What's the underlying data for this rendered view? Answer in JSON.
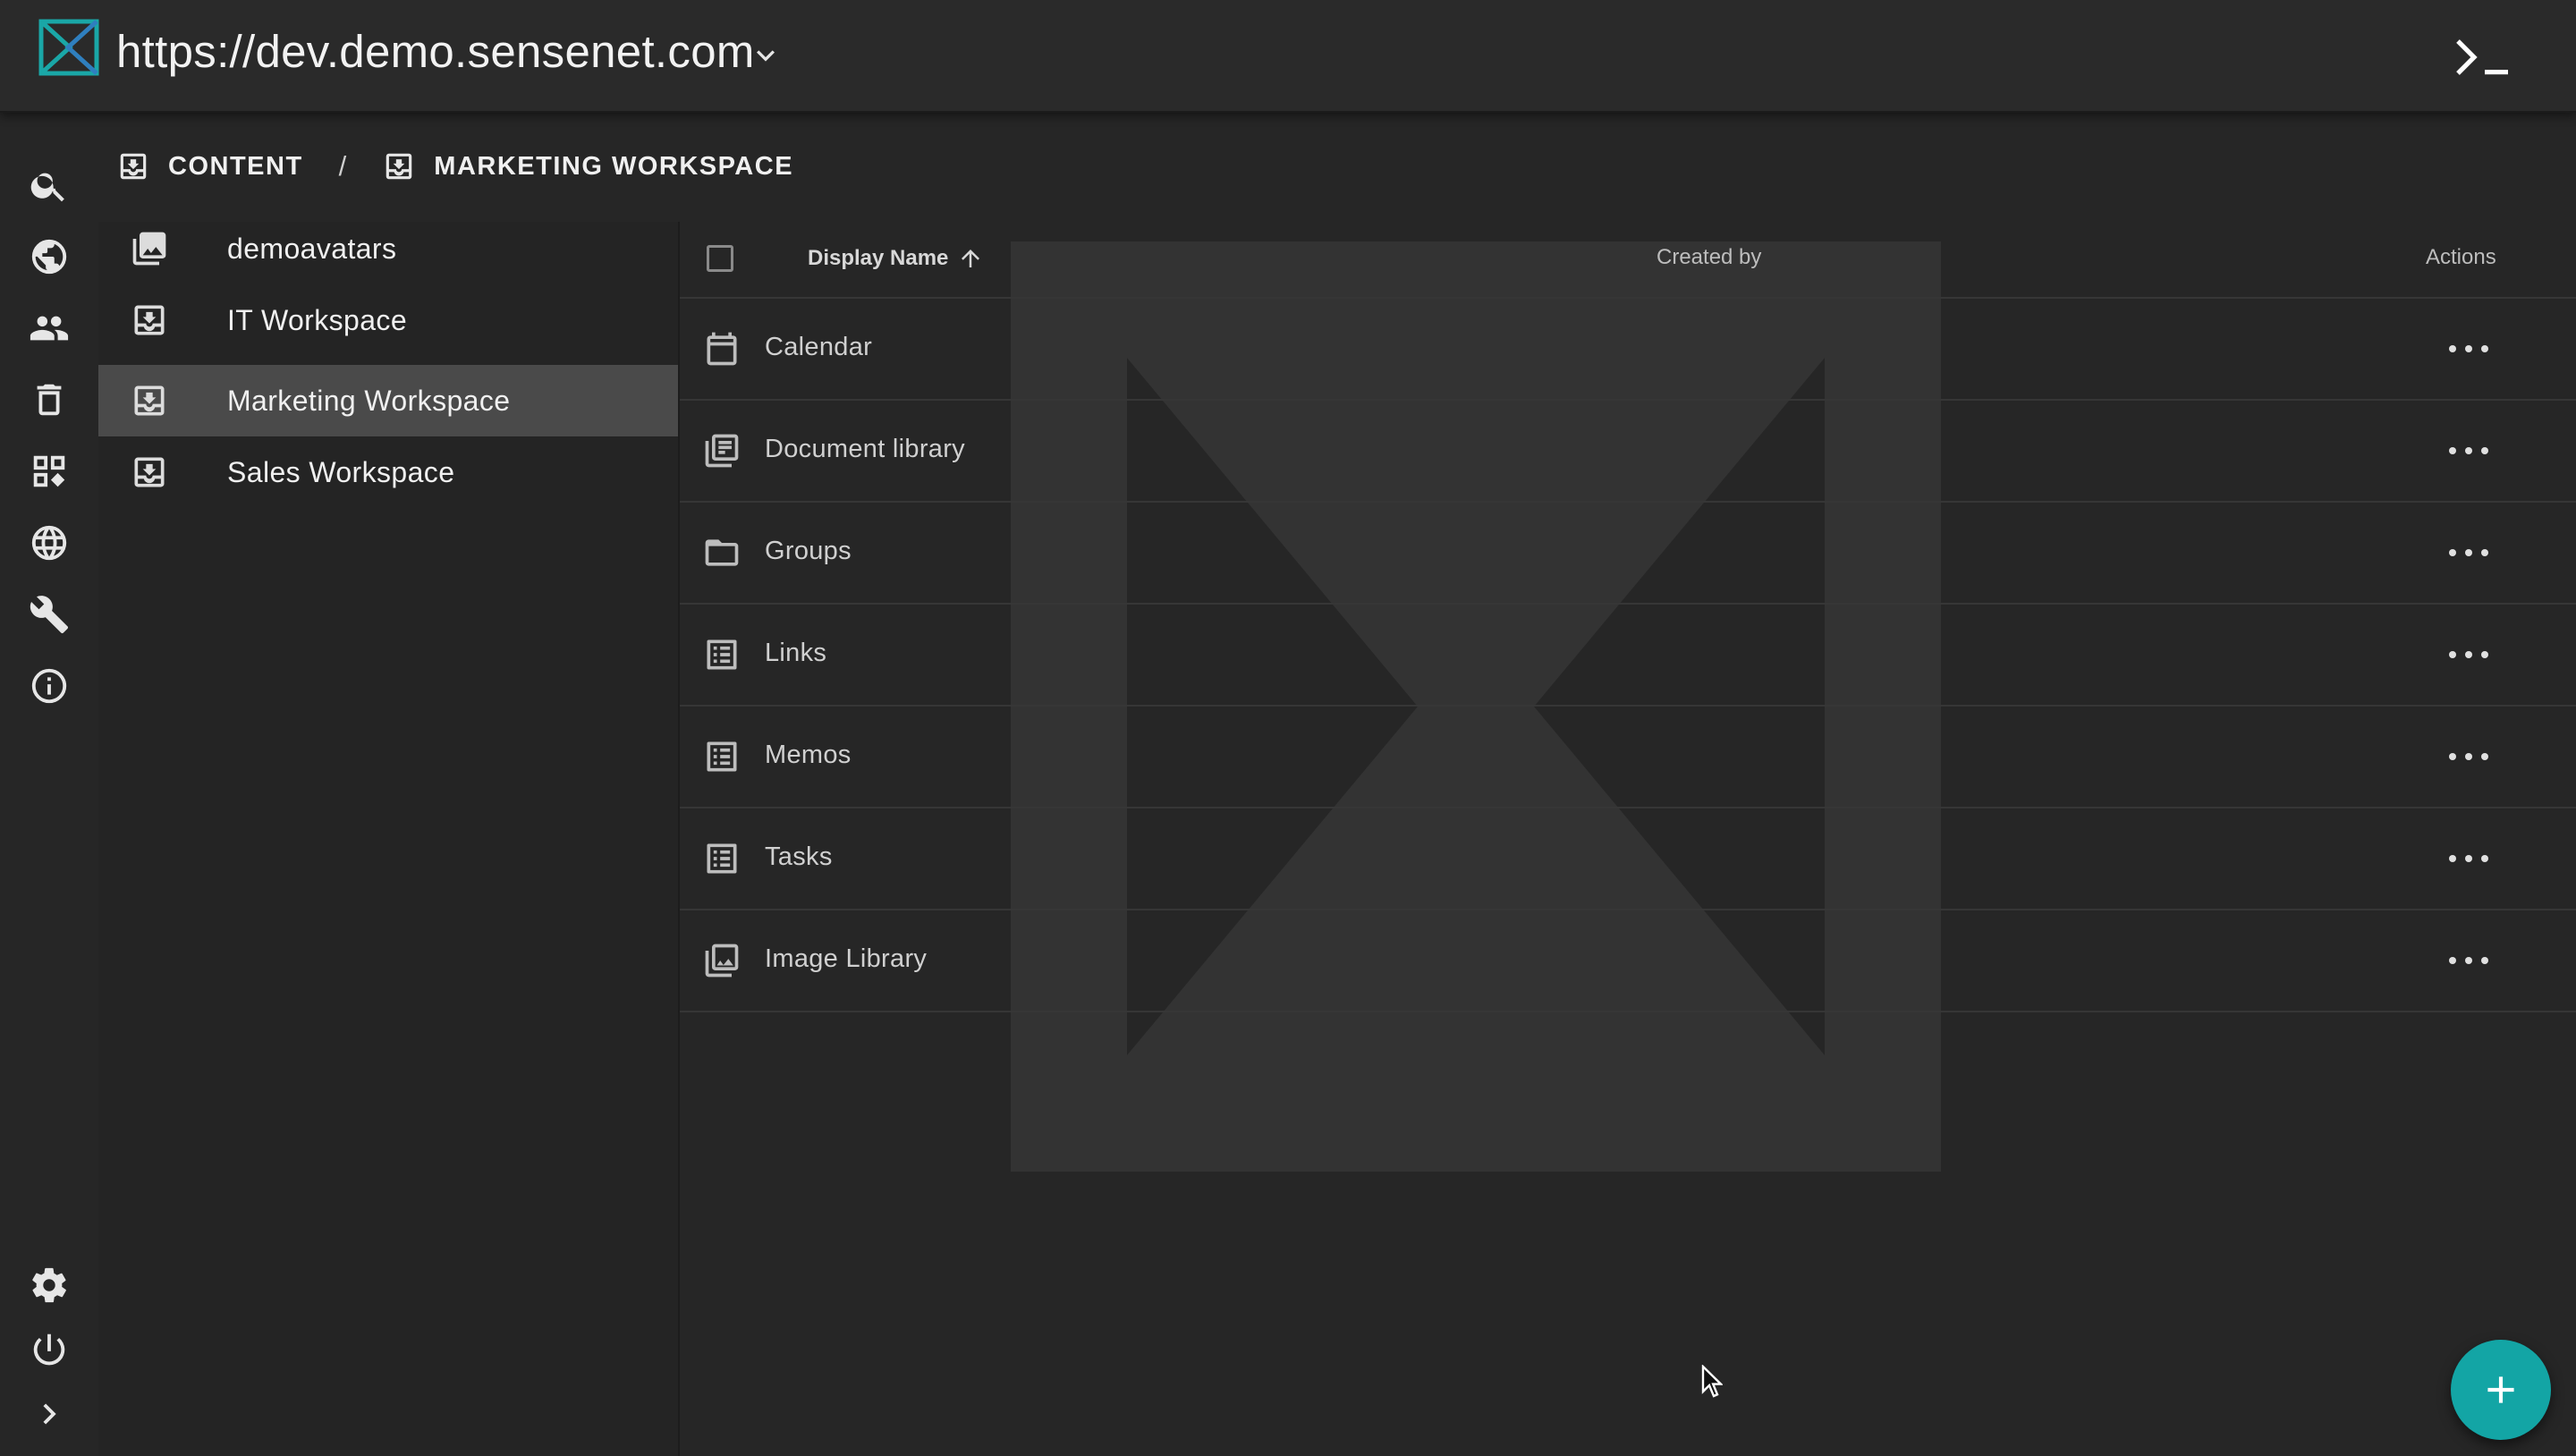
{
  "app": {
    "url": "https://dev.demo.sensenet.com",
    "brand_color": "#13a5a5"
  },
  "rail": {
    "items": [
      {
        "icon": "search-icon"
      },
      {
        "icon": "globe-content-icon"
      },
      {
        "icon": "users-icon"
      },
      {
        "icon": "trash-icon"
      },
      {
        "icon": "content-types-icon"
      },
      {
        "icon": "localization-icon"
      },
      {
        "icon": "setup-wrench-icon"
      },
      {
        "icon": "info-icon"
      },
      {
        "icon": "settings-gear-icon"
      },
      {
        "icon": "power-icon"
      },
      {
        "icon": "expand-chevron-icon"
      }
    ]
  },
  "breadcrumb": {
    "items": [
      "CONTENT",
      "MARKETING WORKSPACE"
    ],
    "separator": "/"
  },
  "tree": {
    "items": [
      {
        "label": "demoavatars",
        "icon": "image-library-icon",
        "selected": false
      },
      {
        "label": "IT Workspace",
        "icon": "workspace-icon",
        "selected": false
      },
      {
        "label": "Marketing Workspace",
        "icon": "workspace-icon",
        "selected": true
      },
      {
        "label": "Sales Workspace",
        "icon": "workspace-icon",
        "selected": false
      }
    ]
  },
  "grid": {
    "columns": {
      "display_name": "Display Name",
      "created_by": "Created by",
      "actions": "Actions"
    },
    "sort": "ascending",
    "rows": [
      {
        "name": "Calendar",
        "icon": "calendar-icon"
      },
      {
        "name": "Document library",
        "icon": "document-library-icon"
      },
      {
        "name": "Groups",
        "icon": "folder-icon"
      },
      {
        "name": "Links",
        "icon": "list-icon"
      },
      {
        "name": "Memos",
        "icon": "list-icon"
      },
      {
        "name": "Tasks",
        "icon": "list-icon"
      },
      {
        "name": "Image Library",
        "icon": "image-library-icon"
      }
    ]
  },
  "fab": {
    "icon": "plus-icon"
  }
}
